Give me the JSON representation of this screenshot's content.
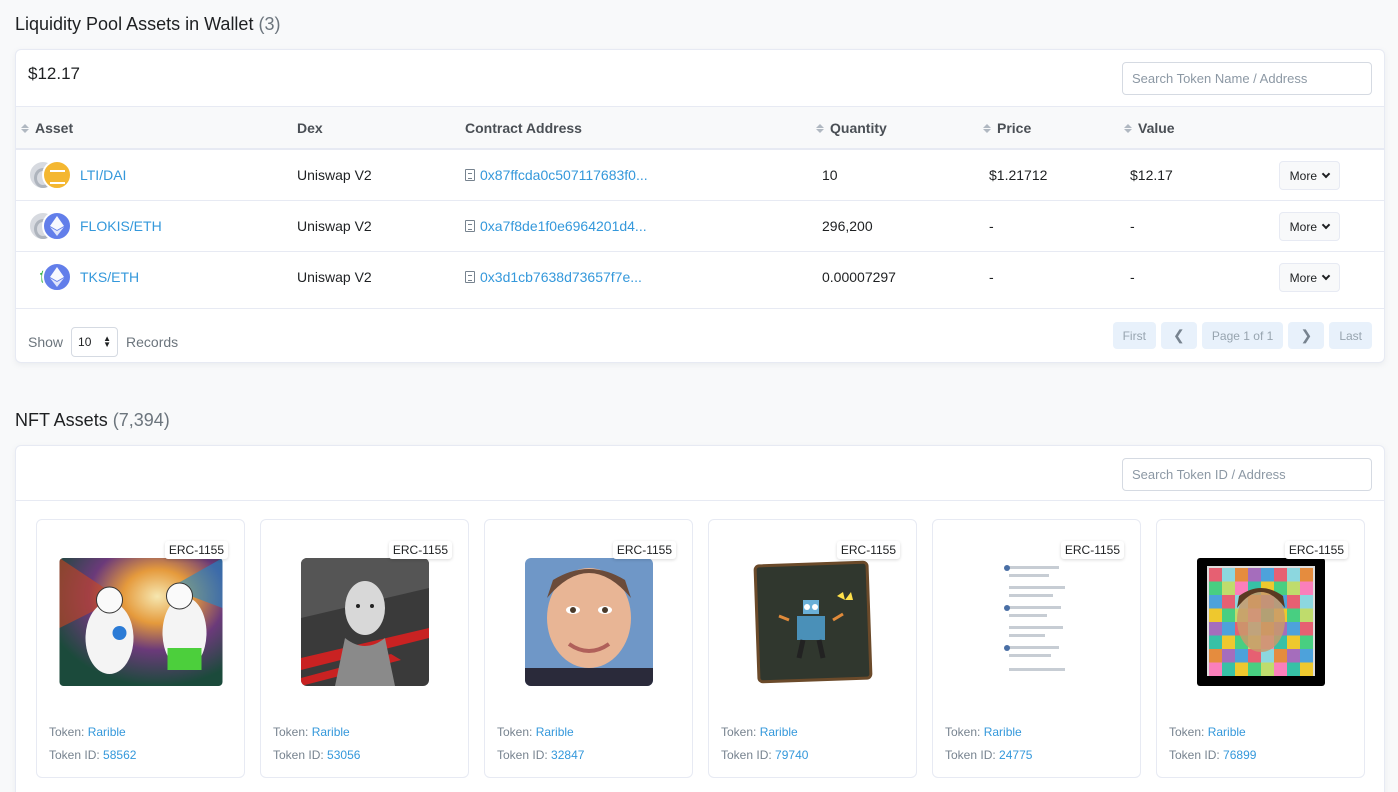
{
  "lp": {
    "title": "Liquidity Pool Assets in Wallet",
    "count": "(3)",
    "total": "$12.17",
    "search_placeholder": "Search Token Name / Address",
    "columns": [
      "Asset",
      "Dex",
      "Contract Address",
      "Quantity",
      "Price",
      "Value"
    ],
    "rows": [
      {
        "asset": "LTI/DAI",
        "dex": "Uniswap V2",
        "address": "0x87ffcda0c507117683f0...",
        "quantity": "10",
        "price": "$1.21712",
        "value": "$12.17",
        "more": "More"
      },
      {
        "asset": "FLOKIS/ETH",
        "dex": "Uniswap V2",
        "address": "0xa7f8de1f0e6964201d4...",
        "quantity": "296,200",
        "price": "-",
        "value": "-",
        "more": "More"
      },
      {
        "asset": "TKS/ETH",
        "dex": "Uniswap V2",
        "address": "0x3d1cb7638d73657f7e...",
        "quantity": "0.00007297",
        "price": "-",
        "value": "-",
        "more": "More"
      }
    ],
    "footer": {
      "show": "Show",
      "records_value": "10",
      "records": "Records",
      "first": "First",
      "page": "Page 1 of 1",
      "last": "Last"
    }
  },
  "nft": {
    "title": "NFT Assets",
    "count": "(7,394)",
    "search_placeholder": "Search Token ID / Address",
    "token_label": "Token:",
    "token_id_label": "Token ID:",
    "items": [
      {
        "standard": "ERC-1155",
        "token": "Rarible",
        "id": "58562"
      },
      {
        "standard": "ERC-1155",
        "token": "Rarible",
        "id": "53056"
      },
      {
        "standard": "ERC-1155",
        "token": "Rarible",
        "id": "32847"
      },
      {
        "standard": "ERC-1155",
        "token": "Rarible",
        "id": "79740"
      },
      {
        "standard": "ERC-1155",
        "token": "Rarible",
        "id": "24775"
      },
      {
        "standard": "ERC-1155",
        "token": "Rarible",
        "id": "76899"
      }
    ]
  },
  "colors": {
    "link": "#3498db",
    "border": "#e7eaf3",
    "pager_bg": "#e8f1fb"
  }
}
